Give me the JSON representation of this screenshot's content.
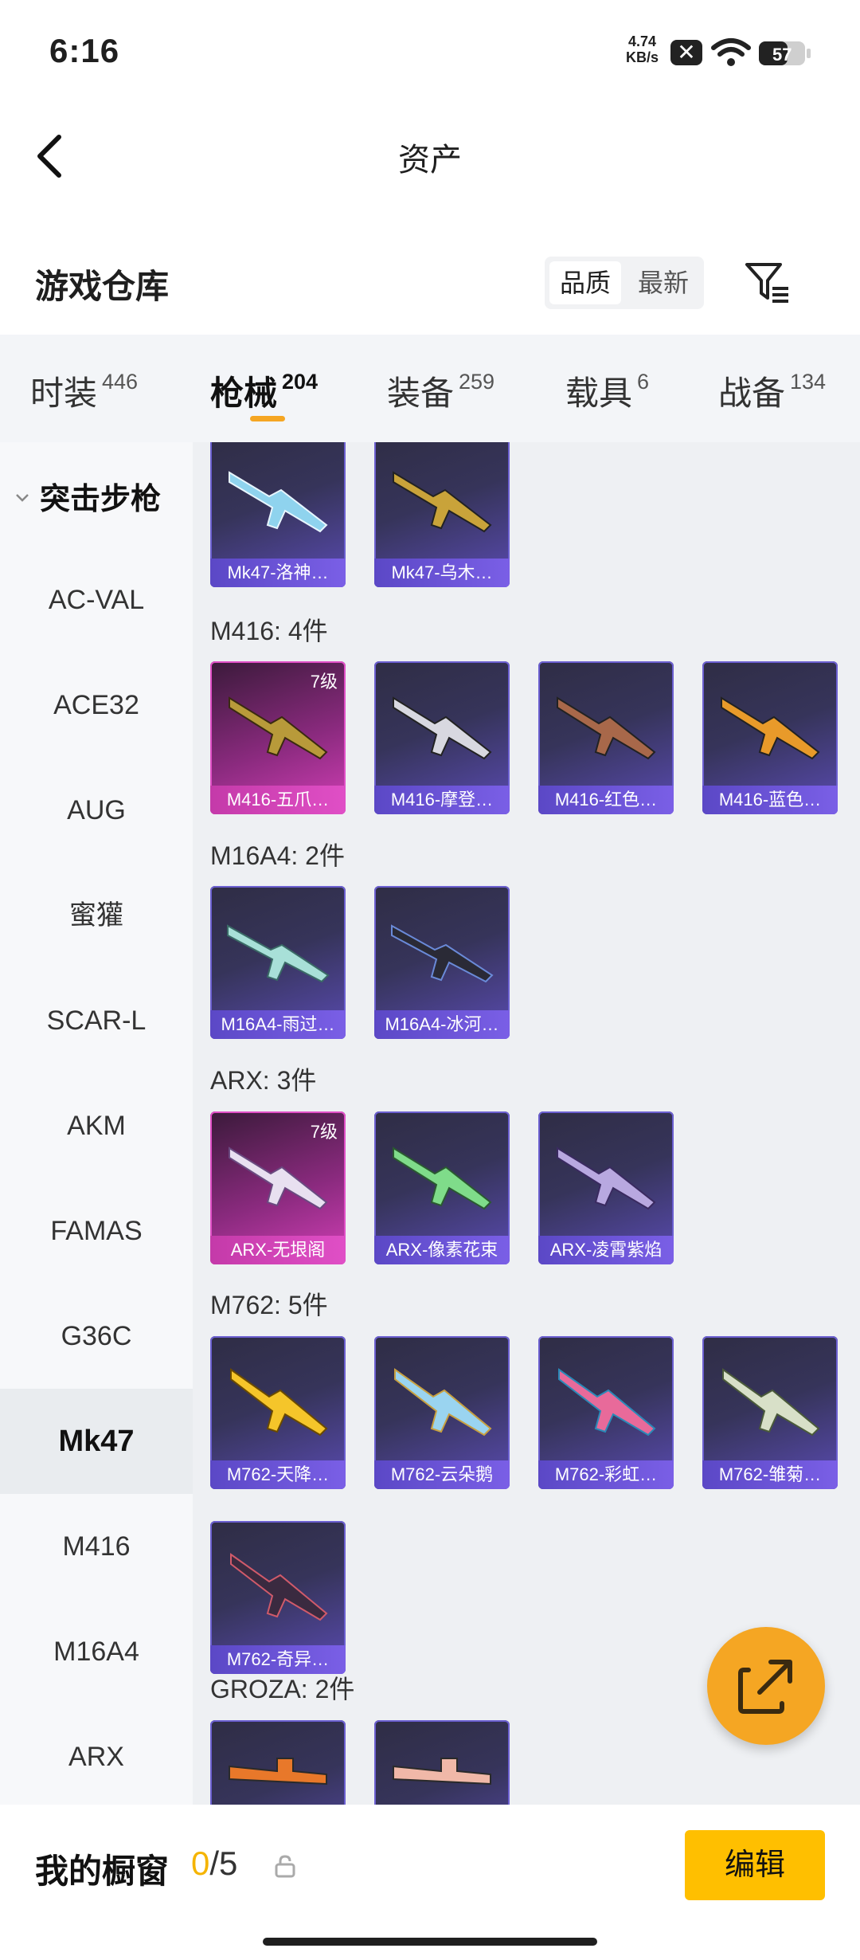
{
  "status_bar": {
    "time": "6:16",
    "net_speed_value": "4.74",
    "net_speed_unit": "KB/s",
    "battery": "57"
  },
  "header": {
    "title": "资产"
  },
  "section": {
    "title": "游戏仓库",
    "sort_active": "品质",
    "sort_inactive": "最新"
  },
  "tabs": [
    {
      "label": "时装",
      "count": "446"
    },
    {
      "label": "枪械",
      "count": "204"
    },
    {
      "label": "装备",
      "count": "259"
    },
    {
      "label": "载具",
      "count": "6"
    },
    {
      "label": "战备",
      "count": "134"
    }
  ],
  "sidebar": {
    "group": "突击步枪",
    "items": [
      "AC-VAL",
      "ACE32",
      "AUG",
      "蜜獾",
      "SCAR-L",
      "AKM",
      "FAMAS",
      "G36C",
      "Mk47",
      "M416",
      "M16A4",
      "ARX"
    ],
    "active": "Mk47"
  },
  "content": {
    "top_cards": [
      "Mk47-洛神…",
      "Mk47-乌木…"
    ],
    "groups": [
      {
        "title": "M416: 4件",
        "cards": [
          {
            "name": "M416-五爪…",
            "level": "7级",
            "rarity": "pink"
          },
          {
            "name": "M416-摩登…",
            "level": "",
            "rarity": "purple"
          },
          {
            "name": "M416-红色…",
            "level": "",
            "rarity": "purple"
          },
          {
            "name": "M416-蓝色…",
            "level": "",
            "rarity": "purple"
          }
        ]
      },
      {
        "title": "M16A4: 2件",
        "cards": [
          {
            "name": "M16A4-雨过…",
            "level": "",
            "rarity": "purple"
          },
          {
            "name": "M16A4-冰河…",
            "level": "",
            "rarity": "purple"
          }
        ]
      },
      {
        "title": "ARX: 3件",
        "cards": [
          {
            "name": "ARX-无垠阁",
            "level": "7级",
            "rarity": "pink"
          },
          {
            "name": "ARX-像素花束",
            "level": "",
            "rarity": "purple"
          },
          {
            "name": "ARX-凌霄紫焰",
            "level": "",
            "rarity": "purple"
          }
        ]
      },
      {
        "title": "M762: 5件",
        "cards": [
          {
            "name": "M762-天降…",
            "level": "",
            "rarity": "purple"
          },
          {
            "name": "M762-云朵鹅",
            "level": "",
            "rarity": "purple"
          },
          {
            "name": "M762-彩虹…",
            "level": "",
            "rarity": "purple"
          },
          {
            "name": "M762-雏菊…",
            "level": "",
            "rarity": "purple"
          },
          {
            "name": "M762-奇异…",
            "level": "",
            "rarity": "purple"
          }
        ]
      },
      {
        "title": "GROZA: 2件",
        "cards": []
      }
    ]
  },
  "bottom_bar": {
    "label": "我的橱窗",
    "current": "0",
    "total": "/5",
    "edit": "编辑"
  },
  "colors": {
    "accent": "#f5a623",
    "edit_button": "#ffbf00",
    "purple_card": "#5b48c6",
    "pink_card": "#e04fc6"
  },
  "icons": [
    "back-arrow-icon",
    "filter-icon",
    "share-out-icon",
    "lock-icon",
    "wifi-icon",
    "battery-icon",
    "chevron-down-icon"
  ]
}
